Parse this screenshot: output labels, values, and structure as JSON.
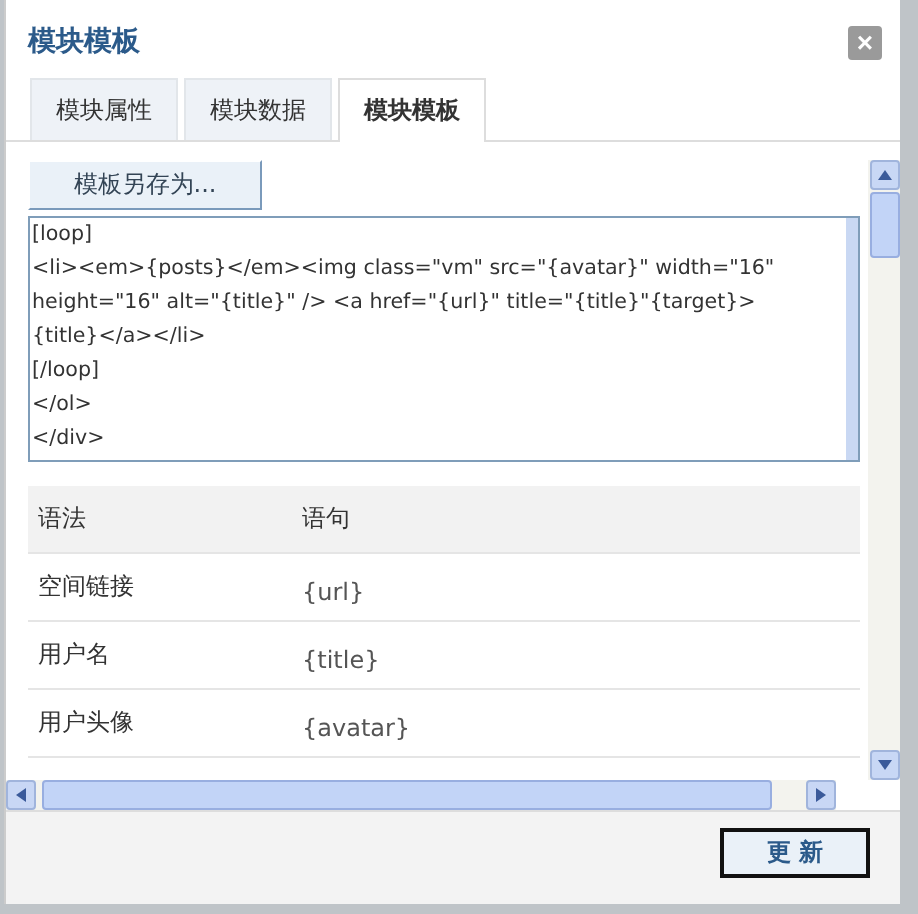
{
  "dialog": {
    "title": "模块模板",
    "close": "×"
  },
  "tabs": [
    {
      "label": "模块属性",
      "selected": false
    },
    {
      "label": "模块数据",
      "selected": false
    },
    {
      "label": "模块模板",
      "selected": true
    }
  ],
  "save_as_button": "模板另存为...",
  "template_lines": [
    "[loop]",
    "<li><em>{posts}</em><img class=\"vm\" src=\"{avatar}\" width=\"16\"",
    "height=\"16\" alt=\"{title}\" /> <a href=\"{url}\" title=\"{title}\"{target}>",
    "{title}</a></li>",
    "[/loop]",
    "</ol>",
    "</div>"
  ],
  "table": {
    "columns": [
      "语法",
      "语句"
    ],
    "rows": [
      [
        "空间链接",
        "{url}"
      ],
      [
        "用户名",
        "{title}"
      ],
      [
        "用户头像",
        "{avatar}"
      ]
    ]
  },
  "update_button": "更 新"
}
